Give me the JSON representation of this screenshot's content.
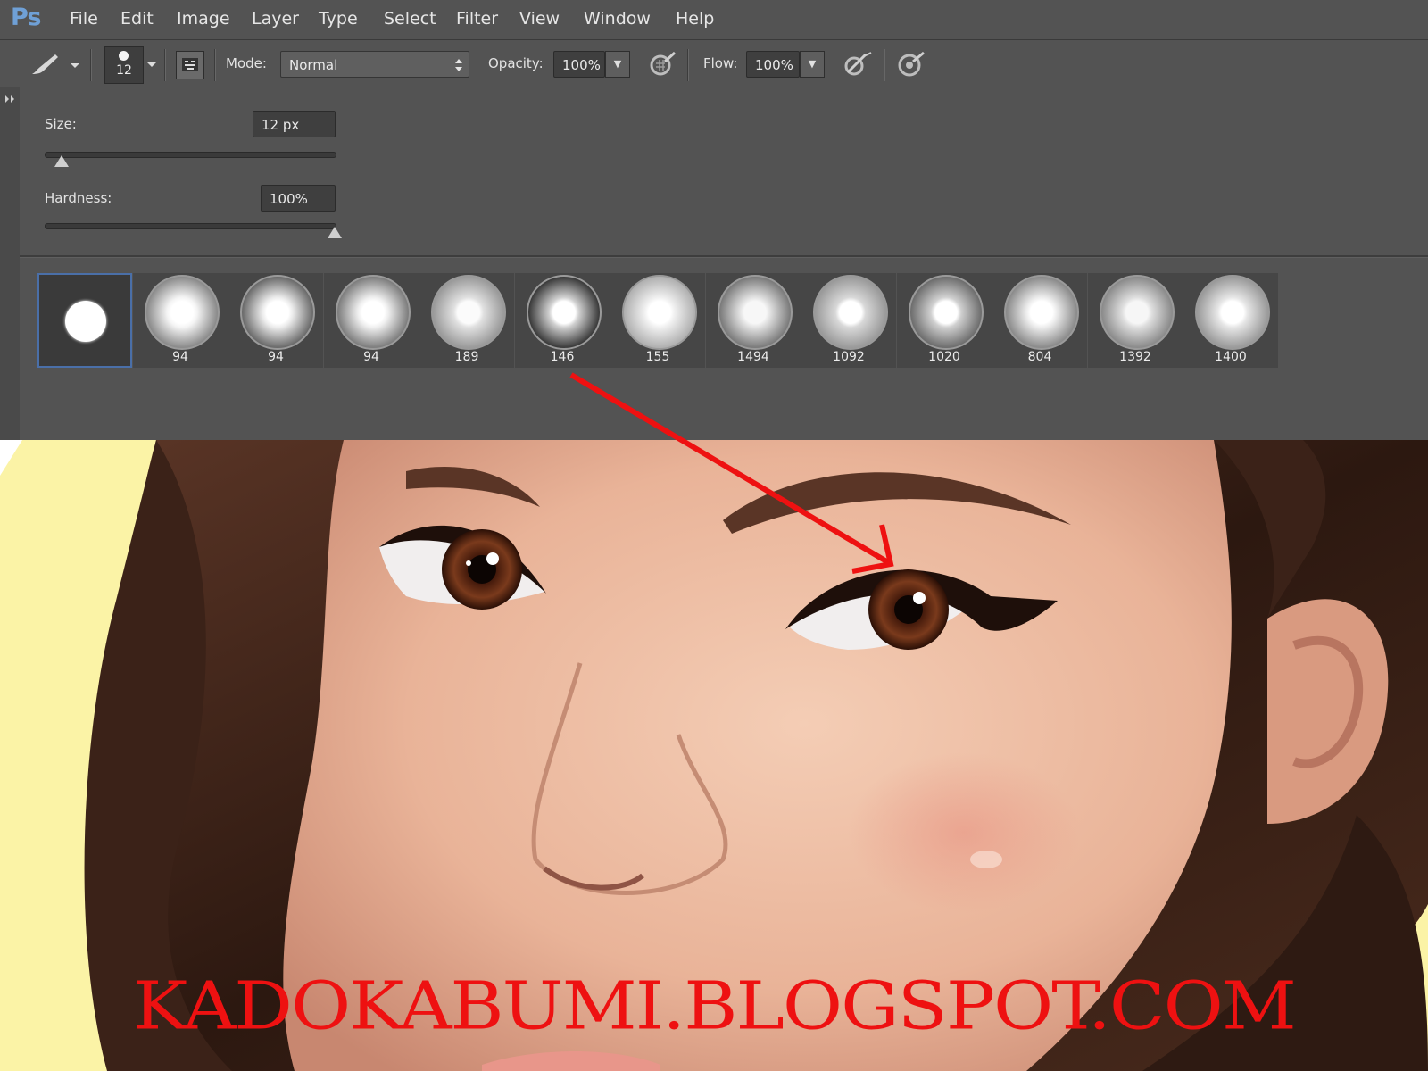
{
  "app": {
    "logo": "Ps"
  },
  "menu": [
    "File",
    "Edit",
    "Image",
    "Layer",
    "Type",
    "Select",
    "Filter",
    "View",
    "Window",
    "Help"
  ],
  "options_bar": {
    "brush_size_badge": "12",
    "mode_label": "Mode:",
    "mode_value": "Normal",
    "opacity_label": "Opacity:",
    "opacity_value": "100%",
    "flow_label": "Flow:",
    "flow_value": "100%"
  },
  "brush_panel": {
    "size_label": "Size:",
    "size_value": "12 px",
    "hardness_label": "Hardness:",
    "hardness_value": "100%",
    "size_slider_fraction": 0.05,
    "hardness_slider_fraction": 1.0,
    "presets": [
      "",
      "94",
      "94",
      "94",
      "189",
      "146",
      "155",
      "1494",
      "1092",
      "1020",
      "804",
      "1392",
      "1400"
    ]
  },
  "watermark": "KADOKABUMI.BLOGSPOT.COM",
  "colors": {
    "ui_gray": "#535353",
    "accent_red": "#ee1111",
    "background_yellow": "#fbf3a6"
  }
}
